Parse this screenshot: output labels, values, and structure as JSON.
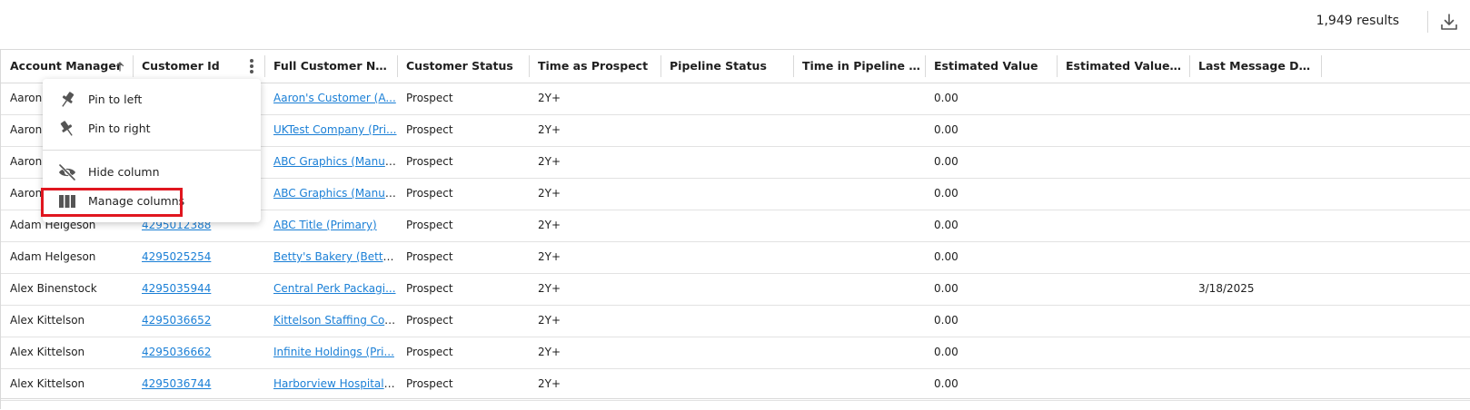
{
  "toolbar": {
    "results_text": "1,949 results",
    "download_icon": "download-icon"
  },
  "columns": [
    {
      "label": "Account Manager"
    },
    {
      "label": "Customer Id"
    },
    {
      "label": "Full Customer Name"
    },
    {
      "label": "Customer Status"
    },
    {
      "label": "Time as Prospect"
    },
    {
      "label": "Pipeline Status"
    },
    {
      "label": "Time in Pipeline Sta..."
    },
    {
      "label": "Estimated Value"
    },
    {
      "label": "Estimated Value Fre..."
    },
    {
      "label": "Last Message Date"
    }
  ],
  "sort": {
    "column": "Account Manager",
    "direction": "ascending",
    "icon": "arrow-up-icon"
  },
  "rows": [
    {
      "manager": "Aaron",
      "id": "",
      "name": "Aaron's Customer (A...",
      "status": "Prospect",
      "time": "2Y+",
      "pipeline": "",
      "pipeline_time": "",
      "value": "0.00",
      "value_freq": "",
      "last_msg": ""
    },
    {
      "manager": "Aaron",
      "id": "",
      "name": "UKTest Company (Pri...",
      "status": "Prospect",
      "time": "2Y+",
      "pipeline": "",
      "pipeline_time": "",
      "value": "0.00",
      "value_freq": "",
      "last_msg": ""
    },
    {
      "manager": "Aaron",
      "id": "",
      "name": "ABC Graphics (Manuf...",
      "status": "Prospect",
      "time": "2Y+",
      "pipeline": "",
      "pipeline_time": "",
      "value": "0.00",
      "value_freq": "",
      "last_msg": ""
    },
    {
      "manager": "Aaron",
      "id": "",
      "name": "ABC Graphics (Manuf...",
      "status": "Prospect",
      "time": "2Y+",
      "pipeline": "",
      "pipeline_time": "",
      "value": "0.00",
      "value_freq": "",
      "last_msg": ""
    },
    {
      "manager": "Adam Helgeson",
      "id": "4295012388",
      "name": "ABC Title (Primary)",
      "status": "Prospect",
      "time": "2Y+",
      "pipeline": "",
      "pipeline_time": "",
      "value": "0.00",
      "value_freq": "",
      "last_msg": ""
    },
    {
      "manager": "Adam Helgeson",
      "id": "4295025254",
      "name": "Betty's Bakery (Betty'...",
      "status": "Prospect",
      "time": "2Y+",
      "pipeline": "",
      "pipeline_time": "",
      "value": "0.00",
      "value_freq": "",
      "last_msg": ""
    },
    {
      "manager": "Alex Binenstock",
      "id": "4295035944",
      "name": "Central Perk Packagi...",
      "status": "Prospect",
      "time": "2Y+",
      "pipeline": "",
      "pipeline_time": "",
      "value": "0.00",
      "value_freq": "",
      "last_msg": "3/18/2025"
    },
    {
      "manager": "Alex Kittelson",
      "id": "4295036652",
      "name": "Kittelson Staffing Co. ...",
      "status": "Prospect",
      "time": "2Y+",
      "pipeline": "",
      "pipeline_time": "",
      "value": "0.00",
      "value_freq": "",
      "last_msg": ""
    },
    {
      "manager": "Alex Kittelson",
      "id": "4295036662",
      "name": "Infinite Holdings (Pri...",
      "status": "Prospect",
      "time": "2Y+",
      "pipeline": "",
      "pipeline_time": "",
      "value": "0.00",
      "value_freq": "",
      "last_msg": ""
    },
    {
      "manager": "Alex Kittelson",
      "id": "4295036744",
      "name": "Harborview Hospital ...",
      "status": "Prospect",
      "time": "2Y+",
      "pipeline": "",
      "pipeline_time": "",
      "value": "0.00",
      "value_freq": "",
      "last_msg": ""
    }
  ],
  "column_menu": {
    "items": [
      {
        "label": "Pin to left",
        "icon": "pin-left-icon"
      },
      {
        "label": "Pin to right",
        "icon": "pin-right-icon"
      },
      {
        "label": "Hide column",
        "icon": "eye-off-icon"
      },
      {
        "label": "Manage columns",
        "icon": "columns-icon"
      }
    ],
    "highlighted_item": "Manage columns",
    "highlight_color": "#e0161f"
  },
  "colors": {
    "link": "#1a7fd6",
    "border": "#d9d9d9"
  }
}
